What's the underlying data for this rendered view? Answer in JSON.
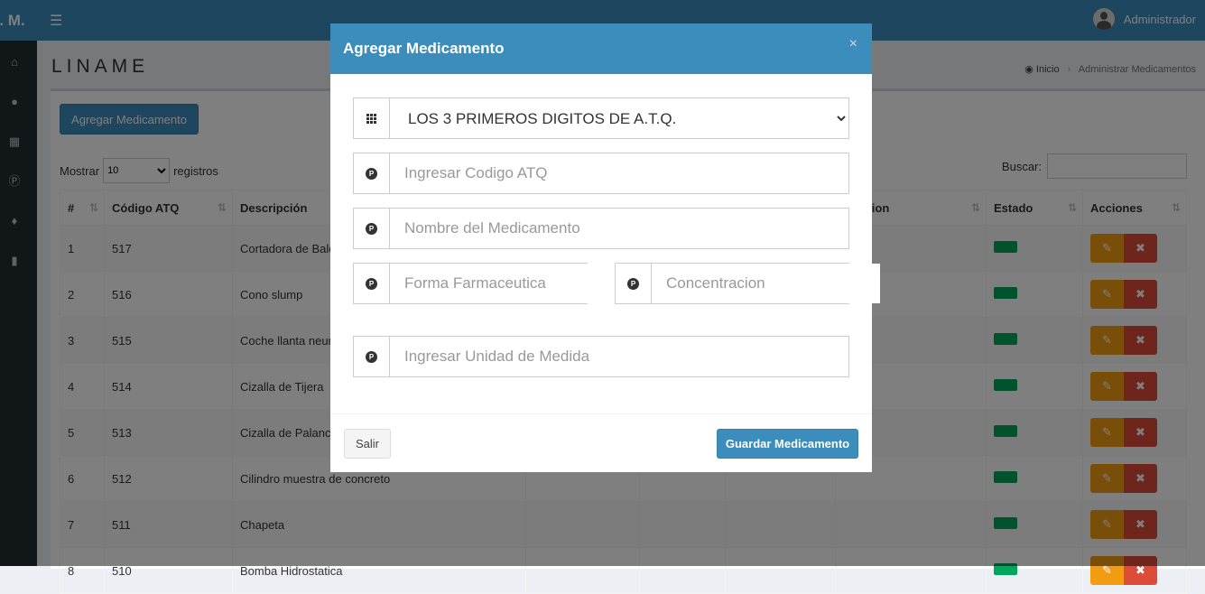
{
  "app": {
    "logo_text": "S. M.",
    "user_name": "Administrador"
  },
  "page": {
    "title": "LINAME",
    "breadcrumb": {
      "home": "Inicio",
      "current": "Administrar Medicamentos"
    }
  },
  "toolbar": {
    "add_label": "Agregar Medicamento"
  },
  "table_controls": {
    "show_label": "Mostrar",
    "page_size": "10",
    "records_label": "registros",
    "search_label": "Buscar:"
  },
  "table": {
    "headers": [
      "#",
      "Código ATQ",
      "Descripción",
      "",
      "",
      "",
      "ntracion",
      "Estado",
      "Acciones"
    ],
    "rows": [
      {
        "num": "1",
        "code": "517",
        "desc": "Cortadora de Bald"
      },
      {
        "num": "2",
        "code": "516",
        "desc": "Cono slump"
      },
      {
        "num": "3",
        "code": "515",
        "desc": "Coche llanta neum"
      },
      {
        "num": "4",
        "code": "514",
        "desc": "Cizalla de Tijera"
      },
      {
        "num": "5",
        "code": "513",
        "desc": "Cizalla de Palanca"
      },
      {
        "num": "6",
        "code": "512",
        "desc": "Cilindro muestra de concreto"
      },
      {
        "num": "7",
        "code": "511",
        "desc": "Chapeta"
      },
      {
        "num": "8",
        "code": "510",
        "desc": "Bomba Hidrostatica"
      }
    ],
    "status_color": "#00a65a"
  },
  "modal": {
    "title": "Agregar Medicamento",
    "close": "×",
    "atq_select": "LOS 3 PRIMEROS DIGITOS DE A.T.Q.",
    "placeholders": {
      "codigo": "Ingresar Codigo ATQ",
      "nombre": "Nombre del Medicamento",
      "forma": "Forma Farmaceutica",
      "concentracion": "Concentracion",
      "unidad": "Ingresar Unidad de Medida"
    },
    "salir_label": "Salir",
    "guardar_label": "Guardar Medicamento"
  },
  "colors": {
    "primary": "#3c8dbc",
    "sidebar": "#222d32",
    "warning": "#f39c12",
    "danger": "#dd4b39"
  }
}
